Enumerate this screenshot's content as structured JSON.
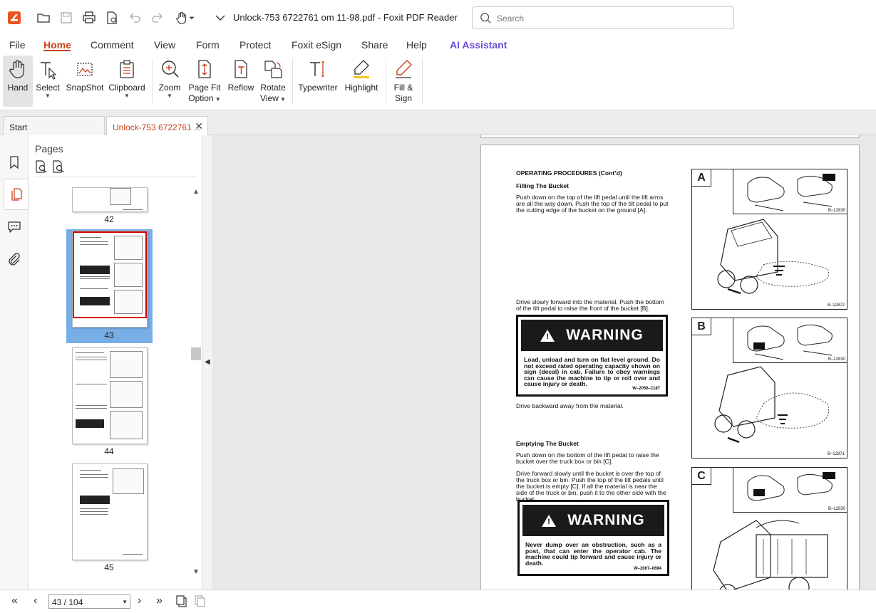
{
  "titlebar": {
    "doc_title": "Unlock-753 6722761 om 11-98.pdf - Foxit PDF Reader",
    "search_placeholder": "Search"
  },
  "menu": {
    "items": [
      "File",
      "Home",
      "Comment",
      "View",
      "Form",
      "Protect",
      "Foxit eSign",
      "Share",
      "Help",
      "AI Assistant"
    ],
    "active": "Home"
  },
  "ribbon": {
    "hand": "Hand",
    "select": "Select",
    "snapshot": "SnapShot",
    "clipboard": "Clipboard",
    "zoom": "Zoom",
    "pagefit_1": "Page Fit",
    "pagefit_2": "Option",
    "reflow": "Reflow",
    "rotate_1": "Rotate",
    "rotate_2": "View",
    "typewriter": "Typewriter",
    "highlight": "Highlight",
    "fillsign_1": "Fill &",
    "fillsign_2": "Sign"
  },
  "tabs": {
    "start": "Start",
    "document": "Unlock-753 6722761 ...",
    "close": "✕"
  },
  "pages_panel": {
    "title": "Pages",
    "thumbs": [
      {
        "number": "42"
      },
      {
        "number": "43",
        "selected": true
      },
      {
        "number": "44"
      },
      {
        "number": "45"
      }
    ]
  },
  "page": {
    "heading": "OPERATING PROCEDURES (Cont’d)",
    "filling_title": "Filling The Bucket",
    "filling_text": "Push down on the top of the lift pedal until the lift arms are all the way down. Push the top of the tilt pedal to put the cutting edge of the bucket on the ground [A].",
    "drive_text": "Drive slowly forward into the material. Push the bottom of the tilt pedal to raise the front of the bucket [B].",
    "warning_1": {
      "title": "WARNING",
      "text": "Load, unload and turn on flat level ground. Do not exceed rated operating capacity shown on sign (decal) in cab. Failure to obey warnings can cause the machine to tip or roll over and cause injury or death.",
      "code": "W–2056–1187"
    },
    "backward_text": "Drive backward away from the material.",
    "emptying_title": "Emptying The Bucket",
    "emptying_text_1": "Push down on the bottom of the lift pedal to raise the bucket over the truck box or bin [C].",
    "emptying_text_2": "Drive forward slowly until the bucket is over the top of the truck box or bin. Push the top of the tilt pedals until the bucket is empty [C]. If all the material is near the side of the truck or bin, push it to the other side with the bucket.",
    "warning_2": {
      "title": "WARNING",
      "text": "Never dump over an obstruction, such as a post, that can enter the operator cab. The machine could tip forward and cause injury or death.",
      "code": "W–2067–0694"
    },
    "figures": [
      {
        "letter": "A",
        "inset_code": "B–12830",
        "code": "B–12872"
      },
      {
        "letter": "B",
        "inset_code": "B–12830",
        "code": "B–12871"
      },
      {
        "letter": "C",
        "inset_code": "B–12830"
      }
    ]
  },
  "statusbar": {
    "page_value": "43 / 104"
  },
  "colors": {
    "accent": "#c8421d",
    "ai": "#6a4cd6",
    "thumb_selected": "#78aee6",
    "thumb_border": "#d00000"
  }
}
